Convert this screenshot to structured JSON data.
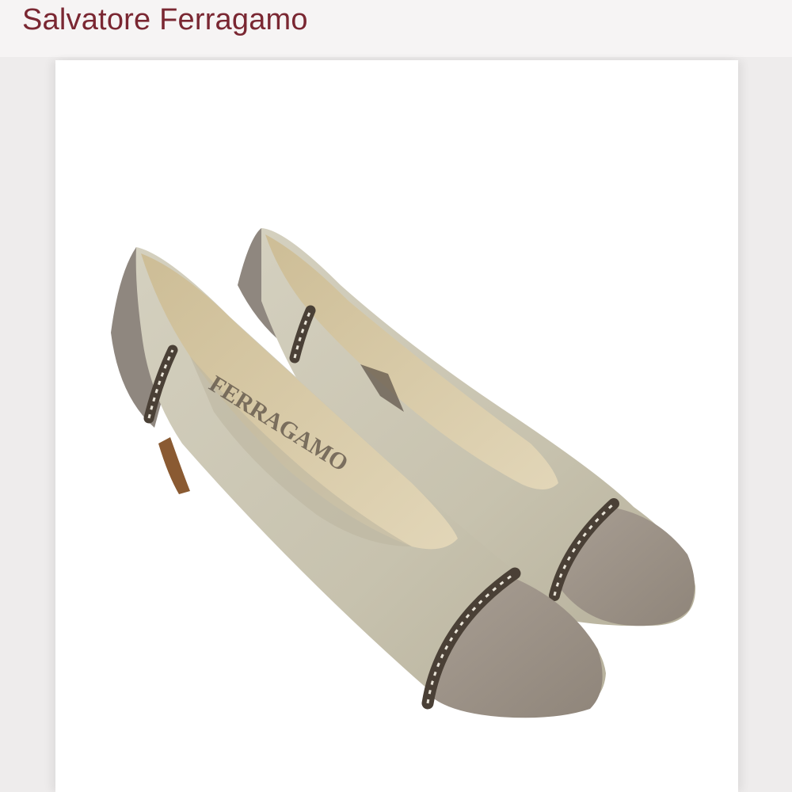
{
  "header": {
    "brand_title": "Salvatore Ferragamo"
  },
  "product_image": {
    "subject": "pair of two-tone leather pumps",
    "logo_text": "FERRAGAMO",
    "colors": {
      "upper": "#c9c4b1",
      "toe_cap": "#9d9288",
      "heel_counter": "#8f877f",
      "trim": "#4a4036",
      "lining": "#d6c7a3",
      "heel_wood": "#8a5a32"
    }
  }
}
